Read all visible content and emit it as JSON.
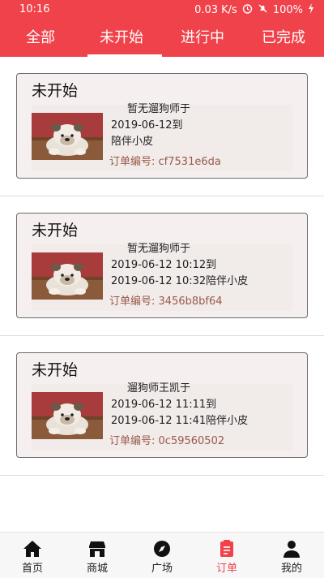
{
  "status_bar": {
    "time": "10:16",
    "speed": "0.03 K/s",
    "battery": "100%"
  },
  "tabs": [
    {
      "label": "全部",
      "active": false
    },
    {
      "label": "未开始",
      "active": true
    },
    {
      "label": "进行中",
      "active": false
    },
    {
      "label": "已完成",
      "active": false
    }
  ],
  "orders": [
    {
      "status": "未开始",
      "line1": "暂无遛狗师于",
      "line2": "2019-06-12到",
      "line3": "陪伴小皮",
      "order_no_label": "订单编号:",
      "order_no": "cf7531e6da"
    },
    {
      "status": "未开始",
      "line1": "暂无遛狗师于",
      "line2": "2019-06-12 10:12到",
      "line3": "2019-06-12 10:32陪伴小皮",
      "order_no_label": "订单编号:",
      "order_no": "3456b8bf64"
    },
    {
      "status": "未开始",
      "line1": "遛狗师王凯于",
      "line2": "2019-06-12 11:11到",
      "line3": "2019-06-12 11:41陪伴小皮",
      "order_no_label": "订单编号:",
      "order_no": "0c59560502"
    }
  ],
  "bottom_nav": [
    {
      "label": "首页",
      "icon": "home-icon",
      "active": false
    },
    {
      "label": "商城",
      "icon": "shop-icon",
      "active": false
    },
    {
      "label": "广场",
      "icon": "compass-icon",
      "active": false
    },
    {
      "label": "订单",
      "icon": "order-icon",
      "active": true
    },
    {
      "label": "我的",
      "icon": "person-icon",
      "active": false
    }
  ],
  "colors": {
    "brand": "#f0424a",
    "order_no": "#9a5a4a"
  }
}
